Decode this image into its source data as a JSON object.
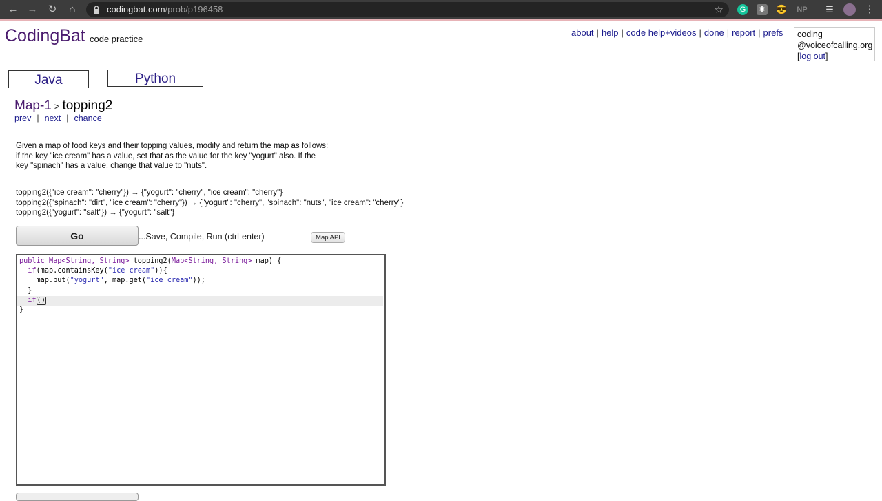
{
  "browser": {
    "url_domain": "codingbat.com",
    "url_path": "/prob/p196458",
    "extensions": [
      {
        "name": "grammarly-icon",
        "color": "#15c39a",
        "glyph": "G"
      },
      {
        "name": "extension-icon",
        "color": "#888888",
        "glyph": "✱"
      },
      {
        "name": "sunglasses-icon",
        "color": "#e3b23c",
        "glyph": "😎"
      },
      {
        "name": "np-icon",
        "color": "#777777",
        "glyph": "NP"
      },
      {
        "name": "reading-list-icon",
        "color": "#cccccc",
        "glyph": "☰"
      },
      {
        "name": "profile-avatar",
        "color": "#8a6f8f",
        "glyph": ""
      }
    ]
  },
  "header": {
    "logo": "CodingBat",
    "tagline": "code practice",
    "nav": [
      "about",
      "help",
      "code help+videos",
      "done",
      "report",
      "prefs"
    ],
    "user_line1": "coding",
    "user_line2": "@voiceofcalling.org",
    "logout": "[log out]",
    "logout_link": "log out"
  },
  "tabs": {
    "java": "Java",
    "python": "Python"
  },
  "problem": {
    "section": "Map-1",
    "separator": ">",
    "name": "topping2",
    "prev": "prev",
    "next": "next",
    "chance": "chance",
    "description": [
      "Given a map of food keys and their topping values, modify and return the map as follows:",
      "if the key \"ice cream\" has a value, set that as the value for the key \"yogurt\" also. If the",
      "key \"spinach\" has a value, change that value to \"nuts\"."
    ],
    "examples": [
      "topping2({\"ice cream\": \"cherry\"}) → {\"yogurt\": \"cherry\", \"ice cream\": \"cherry\"}",
      "topping2({\"spinach\": \"dirt\", \"ice cream\": \"cherry\"}) → {\"yogurt\": \"cherry\", \"spinach\": \"nuts\", \"ice cream\": \"cherry\"}",
      "topping2({\"yogurt\": \"salt\"}) → {\"yogurt\": \"salt\"}"
    ]
  },
  "controls": {
    "go": "Go",
    "hint": "...Save, Compile, Run (ctrl-enter)",
    "map_api": "Map API"
  },
  "editor": {
    "line1_a": "public ",
    "line1_b": "Map<String, String>",
    "line1_c": " topping2(",
    "line1_d": "Map<String, String>",
    "line1_e": " map) {",
    "line2_a": "  if",
    "line2_b": "(map.containsKey(",
    "line2_c": "\"ice cream\"",
    "line2_d": ")){",
    "line3_a": "    map.put(",
    "line3_b": "\"yogurt\"",
    "line3_c": ", map.get(",
    "line3_d": "\"ice cream\"",
    "line3_e": "));",
    "line4": "  }",
    "line5_a": "  if",
    "line5_b": "(",
    "line5_c": ")",
    "line6": "}"
  }
}
